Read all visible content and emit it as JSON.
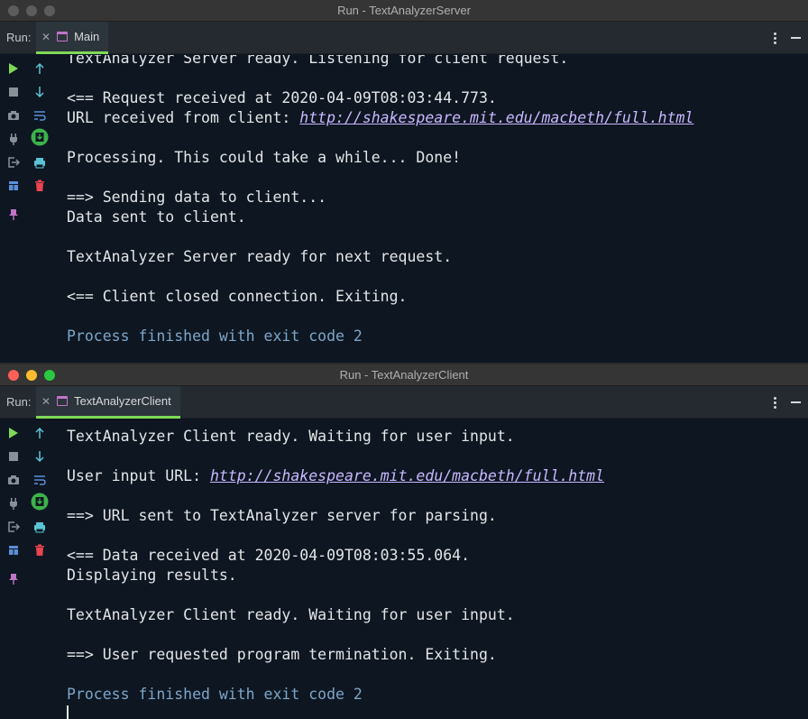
{
  "server": {
    "window_title": "Run - TextAnalyzerServer",
    "run_label": "Run:",
    "tab_label": "Main",
    "lines": [
      {
        "kind": "text",
        "text": "TextAnalyzer Server ready. Listening for client request."
      },
      {
        "kind": "blank"
      },
      {
        "kind": "text",
        "text": "<== Request received at 2020-04-09T08:03:44.773."
      },
      {
        "kind": "link",
        "prefix": "URL received from client: ",
        "link": "http://shakespeare.mit.edu/macbeth/full.html"
      },
      {
        "kind": "blank"
      },
      {
        "kind": "text",
        "text": "Processing. This could take a while... Done!"
      },
      {
        "kind": "blank"
      },
      {
        "kind": "text",
        "text": "==> Sending data to client..."
      },
      {
        "kind": "text",
        "text": "Data sent to client."
      },
      {
        "kind": "blank"
      },
      {
        "kind": "text",
        "text": "TextAnalyzer Server ready for next request."
      },
      {
        "kind": "blank"
      },
      {
        "kind": "text",
        "text": "<== Client closed connection. Exiting."
      },
      {
        "kind": "blank"
      },
      {
        "kind": "exit",
        "text": "Process finished with exit code 2"
      }
    ]
  },
  "client": {
    "window_title": "Run - TextAnalyzerClient",
    "run_label": "Run:",
    "tab_label": "TextAnalyzerClient",
    "lines": [
      {
        "kind": "text",
        "text": "TextAnalyzer Client ready. Waiting for user input."
      },
      {
        "kind": "blank"
      },
      {
        "kind": "link",
        "prefix": "User input URL: ",
        "link": "http://shakespeare.mit.edu/macbeth/full.html"
      },
      {
        "kind": "blank"
      },
      {
        "kind": "text",
        "text": "==> URL sent to TextAnalyzer server for parsing."
      },
      {
        "kind": "blank"
      },
      {
        "kind": "text",
        "text": "<== Data received at 2020-04-09T08:03:55.064."
      },
      {
        "kind": "text",
        "text": "Displaying results."
      },
      {
        "kind": "blank"
      },
      {
        "kind": "text",
        "text": "TextAnalyzer Client ready. Waiting for user input."
      },
      {
        "kind": "blank"
      },
      {
        "kind": "text",
        "text": "==> User requested program termination. Exiting."
      },
      {
        "kind": "blank"
      },
      {
        "kind": "exit",
        "text": "Process finished with exit code 2"
      },
      {
        "kind": "cursor"
      }
    ]
  },
  "toolbar_icons": {
    "col1": [
      "run-icon",
      "stop-icon",
      "camera-icon",
      "plug-icon",
      "exit-icon",
      "layout-icon",
      "pin-icon"
    ],
    "col2": [
      "up-arrow-icon",
      "down-arrow-icon",
      "soft-wrap-icon",
      "scroll-to-end-icon",
      "print-icon",
      "trash-icon"
    ]
  },
  "colors": {
    "console_bg": "#0e1621",
    "console_text": "#e3e6e8",
    "link": "#c8b8ff",
    "exit_text": "#7ea6c8",
    "tab_underline": "#7ed957"
  }
}
